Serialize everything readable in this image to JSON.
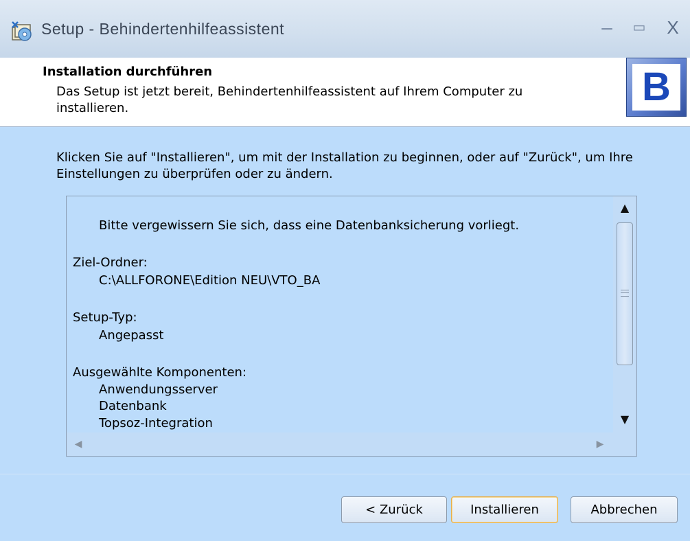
{
  "window": {
    "title": "Setup - Behindertenhilfeassistent",
    "controls": {
      "minimize": "–",
      "maximize": "▭",
      "close": "X"
    }
  },
  "header": {
    "title": "Installation durchführen",
    "description": "Das Setup ist jetzt bereit, Behindertenhilfeassistent auf Ihrem Computer zu installieren.",
    "logo_letter": "B"
  },
  "intro_text": "Klicken Sie auf \"Installieren\", um mit der Installation zu beginnen, oder auf \"Zurück\", um Ihre Einstellungen zu überprüfen oder zu ändern.",
  "summary": {
    "notice": "Bitte vergewissern Sie sich, dass eine Datenbanksicherung vorliegt.",
    "target_folder_label": "Ziel-Ordner:",
    "target_folder_value": "C:\\ALLFORONE\\Edition NEU\\VTO_BA",
    "setup_type_label": "Setup-Typ:",
    "setup_type_value": "Angepasst",
    "components_label": "Ausgewählte Komponenten:",
    "components": [
      "Anwendungsserver",
      "Datenbank",
      "Topsoz-Integration"
    ]
  },
  "buttons": {
    "back": "< Zurück",
    "install": "Installieren",
    "cancel": "Abbrechen"
  },
  "colors": {
    "body_background": "#bcdcfb",
    "header_background": "#ffffff",
    "default_button_border": "#e8b04b"
  }
}
